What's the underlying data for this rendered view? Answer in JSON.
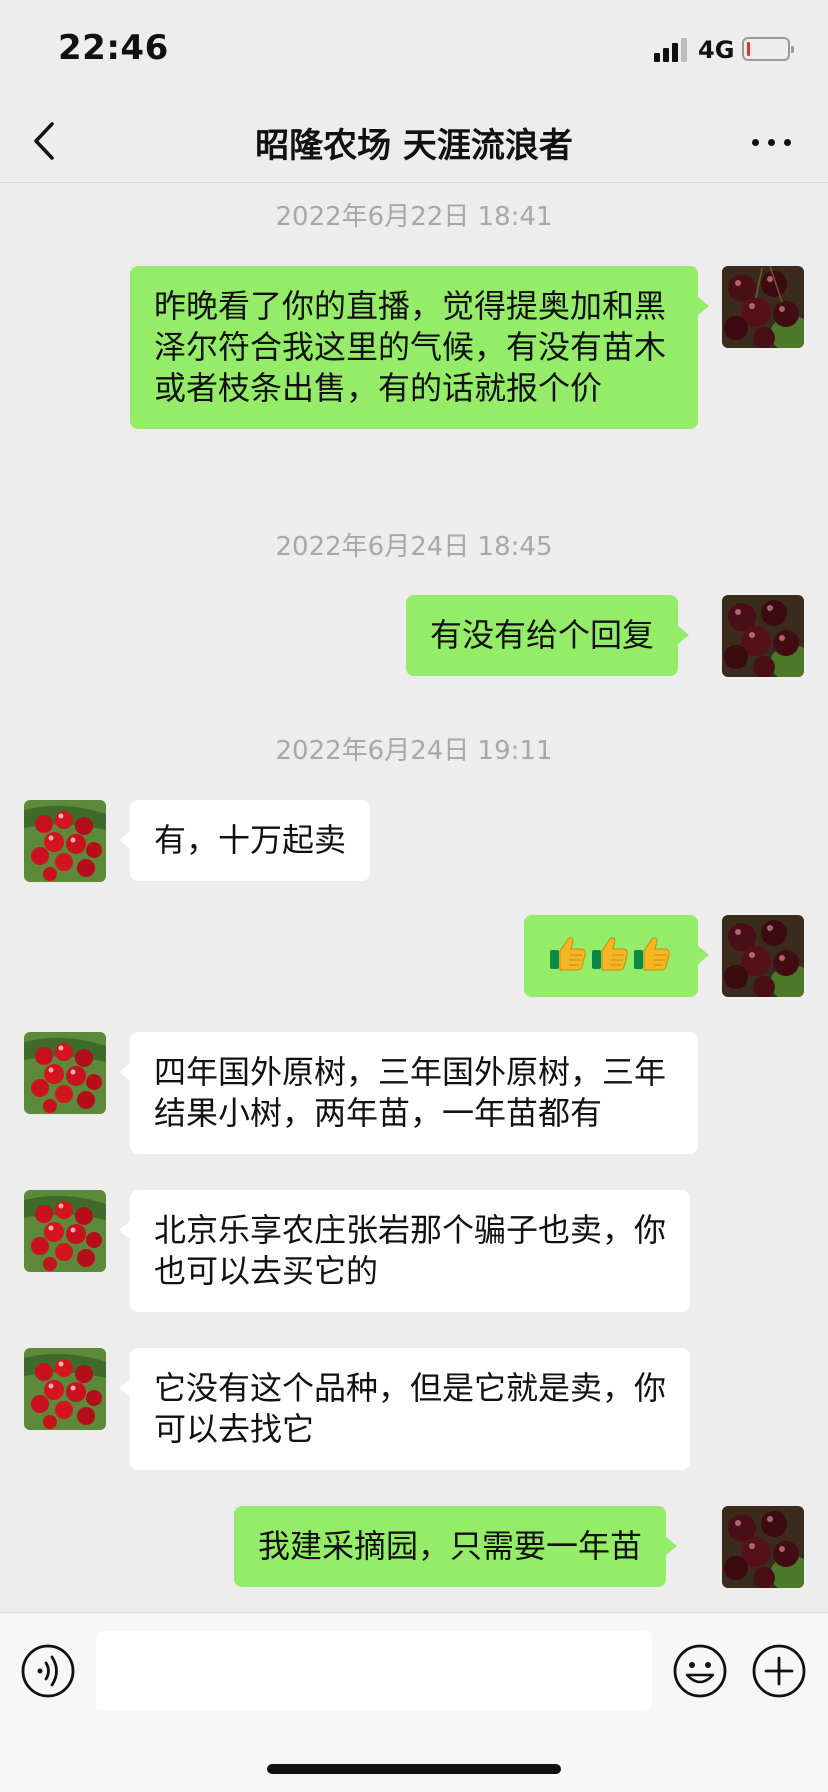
{
  "status_bar": {
    "time": "22:46",
    "network": "4G",
    "battery_level": 0.05,
    "battery_color": "#e5322d"
  },
  "header": {
    "title": "昭隆农场 天涯流浪者",
    "back_icon": "chevron-left-icon",
    "more_icon": "ellipsis-icon"
  },
  "colors": {
    "my_bubble": "#95ec69",
    "their_bubble": "#ffffff",
    "background": "#ededed"
  },
  "messages": [
    {
      "type": "timestamp",
      "text": "2022年6月22日 18:41"
    },
    {
      "type": "message",
      "sender": "me",
      "text": "昨晚看了你的直播，觉得提奥加和黑泽尔符合我这里的气候，有没有苗木或者枝条出售，有的话就报个价"
    },
    {
      "type": "timestamp",
      "text": "2022年6月24日 18:45"
    },
    {
      "type": "message",
      "sender": "me",
      "text": "有没有给个回复"
    },
    {
      "type": "timestamp",
      "text": "2022年6月24日 19:11"
    },
    {
      "type": "message",
      "sender": "them",
      "text": "有，十万起卖"
    },
    {
      "type": "message",
      "sender": "me",
      "emoji": "thumbs-up-icon",
      "emoji_count": 3
    },
    {
      "type": "message",
      "sender": "them",
      "text": "四年国外原树，三年国外原树，三年结果小树，两年苗，一年苗都有"
    },
    {
      "type": "message",
      "sender": "them",
      "text": "北京乐享农庄张岩那个骗子也卖，你也可以去买它的"
    },
    {
      "type": "message",
      "sender": "them",
      "text": "它没有这个品种，但是它就是卖，你可以去找它"
    },
    {
      "type": "message",
      "sender": "me",
      "text": "我建采摘园，只需要一年苗"
    }
  ],
  "input_bar": {
    "voice_icon": "voice-icon",
    "input_value": "",
    "emoji_icon": "emoji-icon",
    "plus_icon": "plus-icon"
  }
}
